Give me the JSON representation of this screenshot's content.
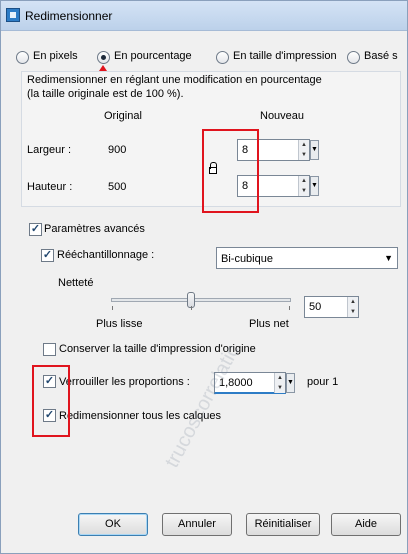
{
  "window": {
    "title": "Redimensionner",
    "app_icon": "paintshop-icon"
  },
  "mode": {
    "options": [
      {
        "label": "En pixels",
        "checked": false
      },
      {
        "label": "En pourcentage",
        "checked": true
      },
      {
        "label": "En taille d'impression",
        "checked": false
      },
      {
        "label": "Basé s",
        "checked": false
      }
    ]
  },
  "description": {
    "line1": "Redimensionner en réglant une modification en pourcentage",
    "line2": "(la taille originale est de 100 %)."
  },
  "dimensions": {
    "col_original": "Original",
    "col_new": "Nouveau",
    "width_label": "Largeur :",
    "width_original": "900",
    "width_new": "8",
    "height_label": "Hauteur :",
    "height_original": "500",
    "height_new": "8"
  },
  "advanced": {
    "label": "Paramètres avancés",
    "checked": true,
    "resample_label": "Rééchantillonnage :",
    "resample_checked": true,
    "resample_value": "Bi-cubique",
    "sharpness_label": "Netteté",
    "sharpness_min_label": "Plus lisse",
    "sharpness_max_label": "Plus net",
    "sharpness_value": "50",
    "keep_print_label": "Conserver la taille d'impression d'origine",
    "keep_print_checked": false,
    "lock_ratio_label": "Verrouiller les proportions :",
    "lock_ratio_checked": true,
    "ratio_value": "1,8000",
    "ratio_suffix": "pour 1",
    "resize_layers_label": "Redimensionner tous les calques",
    "resize_layers_checked": true
  },
  "buttons": {
    "ok": "OK",
    "cancel": "Annuler",
    "reset": "Réinitialiser",
    "help": "Aide"
  },
  "watermark": "trucoscorrelatic",
  "colors": {
    "annotation_red": "#e0141e",
    "accent_blue": "#2d7cc6"
  }
}
